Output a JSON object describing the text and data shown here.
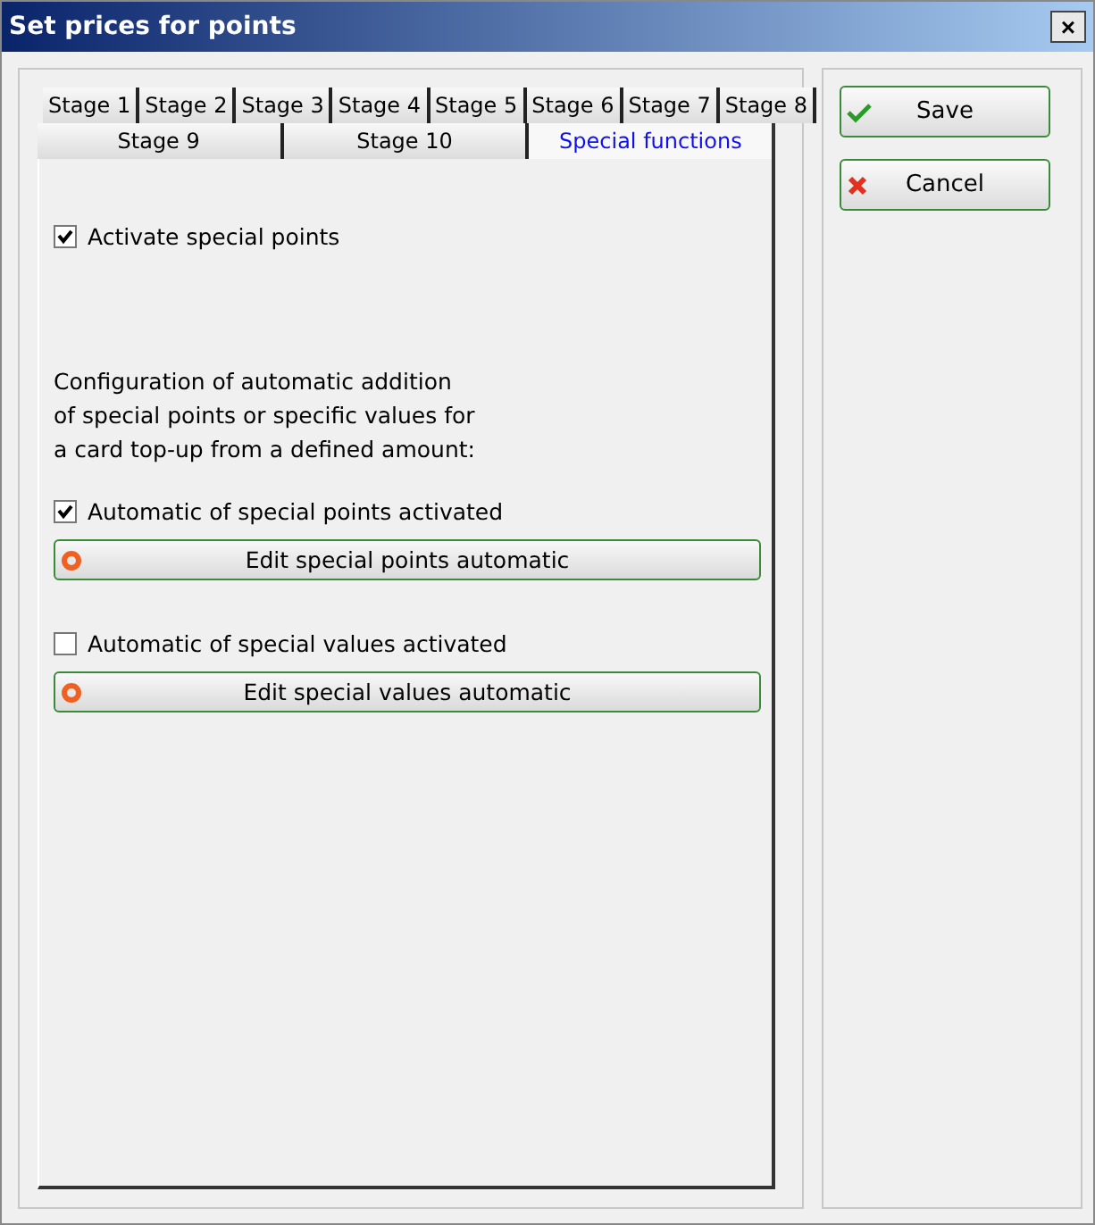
{
  "window": {
    "title": "Set prices for points",
    "close": "×"
  },
  "tab_rows": [
    [
      {
        "label": "Stage 1",
        "selected": false
      },
      {
        "label": "Stage 2",
        "selected": false
      },
      {
        "label": "Stage 3",
        "selected": false
      },
      {
        "label": "Stage 4",
        "selected": false
      },
      {
        "label": "Stage 5",
        "selected": false
      },
      {
        "label": "Stage 6",
        "selected": false
      },
      {
        "label": "Stage 7",
        "selected": false
      },
      {
        "label": "Stage 8",
        "selected": false
      }
    ],
    [
      {
        "label": "Stage 9",
        "selected": false
      },
      {
        "label": "Stage 10",
        "selected": false
      },
      {
        "label": "Special functions",
        "selected": true
      }
    ]
  ],
  "content": [
    {
      "kind": "checkbox",
      "label": "Activate special points",
      "checked": true
    },
    {
      "kind": "spacer"
    },
    {
      "kind": "text",
      "lines": [
        "Configuration of automatic addition",
        "of special points or specific values for",
        "a card top-up from a defined amount:"
      ]
    },
    {
      "kind": "checkbox",
      "label": "Automatic of special points activated",
      "checked": true
    },
    {
      "kind": "button",
      "label": "Edit special points automatic"
    },
    {
      "kind": "checkbox",
      "label": "Automatic of special values activated",
      "checked": false
    },
    {
      "kind": "button",
      "label": "Edit special values automatic"
    }
  ],
  "actions": [
    {
      "kind": "save",
      "label": "Save"
    },
    {
      "kind": "cancel",
      "label": "Cancel"
    }
  ]
}
